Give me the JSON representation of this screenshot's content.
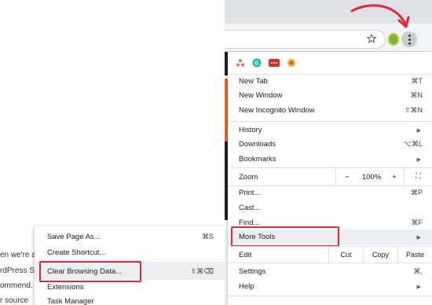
{
  "colors": {
    "annotation": "#e2263d",
    "menu_highlight": "#eceff1",
    "page_orange": "#f26522"
  },
  "toolbar": {
    "star_icon": "star-icon",
    "extension_icon": "evernote-extension-icon",
    "menu_icon": "kebab-menu-icon"
  },
  "extensions": [
    "asana-icon",
    "grammarly-icon",
    "red-extension-icon",
    "gear-extension-icon"
  ],
  "menu": {
    "new_tab": {
      "label": "New Tab",
      "shortcut": "⌘T"
    },
    "new_window": {
      "label": "New Window",
      "shortcut": "⌘N"
    },
    "new_incognito": {
      "label": "New Incognito Window",
      "shortcut": "⇧⌘N"
    },
    "history": {
      "label": "History",
      "arrow": "▶"
    },
    "downloads": {
      "label": "Downloads",
      "shortcut": "⌥⌘L"
    },
    "bookmarks": {
      "label": "Bookmarks",
      "arrow": "▶"
    },
    "zoom": {
      "label": "Zoom",
      "minus": "−",
      "level": "100%",
      "plus": "+",
      "fullscreen": "⛶"
    },
    "print": {
      "label": "Print...",
      "shortcut": "⌘P"
    },
    "cast": {
      "label": "Cast..."
    },
    "find": {
      "label": "Find...",
      "shortcut": "⌘F"
    },
    "more_tools": {
      "label": "More Tools",
      "arrow": "▶"
    },
    "edit": {
      "label": "Edit",
      "cut": "Cut",
      "copy": "Copy",
      "paste": "Paste"
    },
    "settings": {
      "label": "Settings",
      "shortcut": "⌘,"
    },
    "help": {
      "label": "Help",
      "arrow": "▶"
    }
  },
  "submenu": {
    "save_page": {
      "label": "Save Page As...",
      "shortcut": "⌘S"
    },
    "create_shortcut": {
      "label": "Create Shortcut..."
    },
    "clear_browsing": {
      "label": "Clear Browsing Data...",
      "shortcut": "⇧⌘⌫"
    },
    "extensions": {
      "label": "Extensions"
    },
    "task_manager": {
      "label": "Task Manager"
    }
  },
  "background_text": [
    "en we're a",
    "rdPress SE",
    "ommend.",
    "r source"
  ]
}
